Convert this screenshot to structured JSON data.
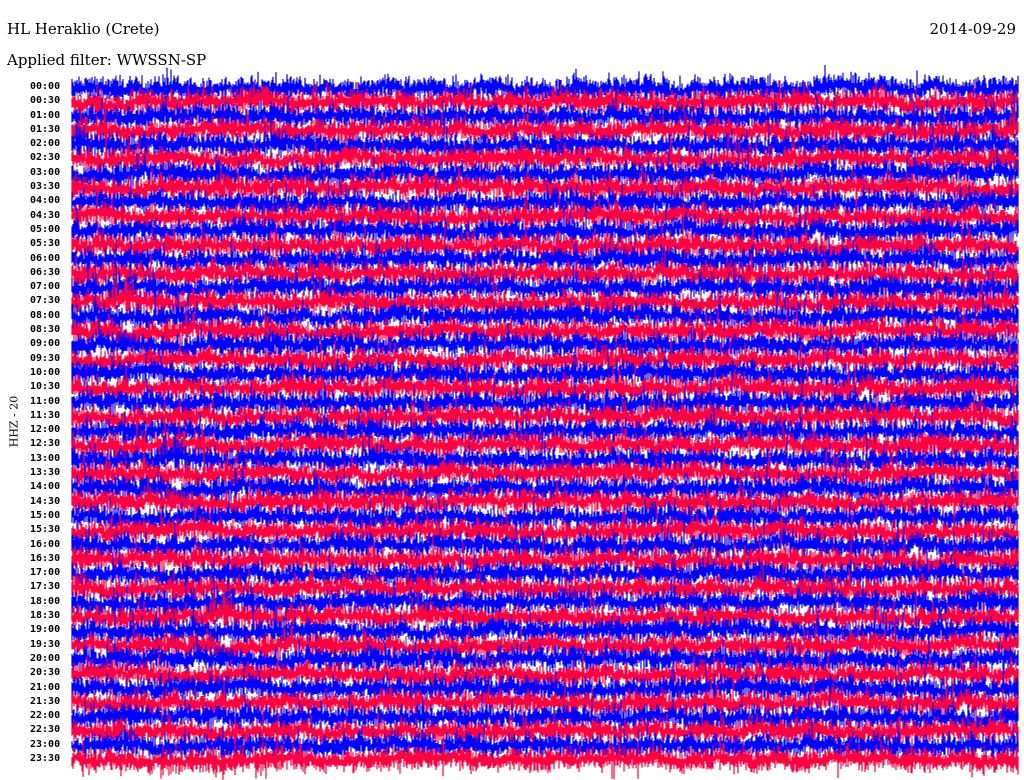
{
  "header": {
    "station": "HL Heraklio (Crete)",
    "date": "2014-09-29",
    "filter": "Applied filter: WWSSN-SP"
  },
  "chart_data": {
    "type": "line",
    "title": "HL Heraklio (Crete)",
    "subtitle": "Applied filter: WWSSN-SP",
    "date": "2014-09-29",
    "ylabel": "HHZ - 20",
    "row_labels": [
      "00:00",
      "00:30",
      "01:00",
      "01:30",
      "02:00",
      "02:30",
      "03:00",
      "03:30",
      "04:00",
      "04:30",
      "05:00",
      "05:30",
      "06:00",
      "06:30",
      "07:00",
      "07:30",
      "08:00",
      "08:30",
      "09:00",
      "09:30",
      "10:00",
      "10:30",
      "11:00",
      "11:30",
      "12:00",
      "12:30",
      "13:00",
      "13:30",
      "14:00",
      "14:30",
      "15:00",
      "15:30",
      "16:00",
      "16:30",
      "17:00",
      "17:30",
      "18:00",
      "18:30",
      "19:00",
      "19:30",
      "20:00",
      "20:30",
      "21:00",
      "21:30",
      "22:00",
      "22:30",
      "23:00",
      "23:30"
    ],
    "series_colors": [
      "#0000ff",
      "#ff0040"
    ],
    "grid": false
  }
}
